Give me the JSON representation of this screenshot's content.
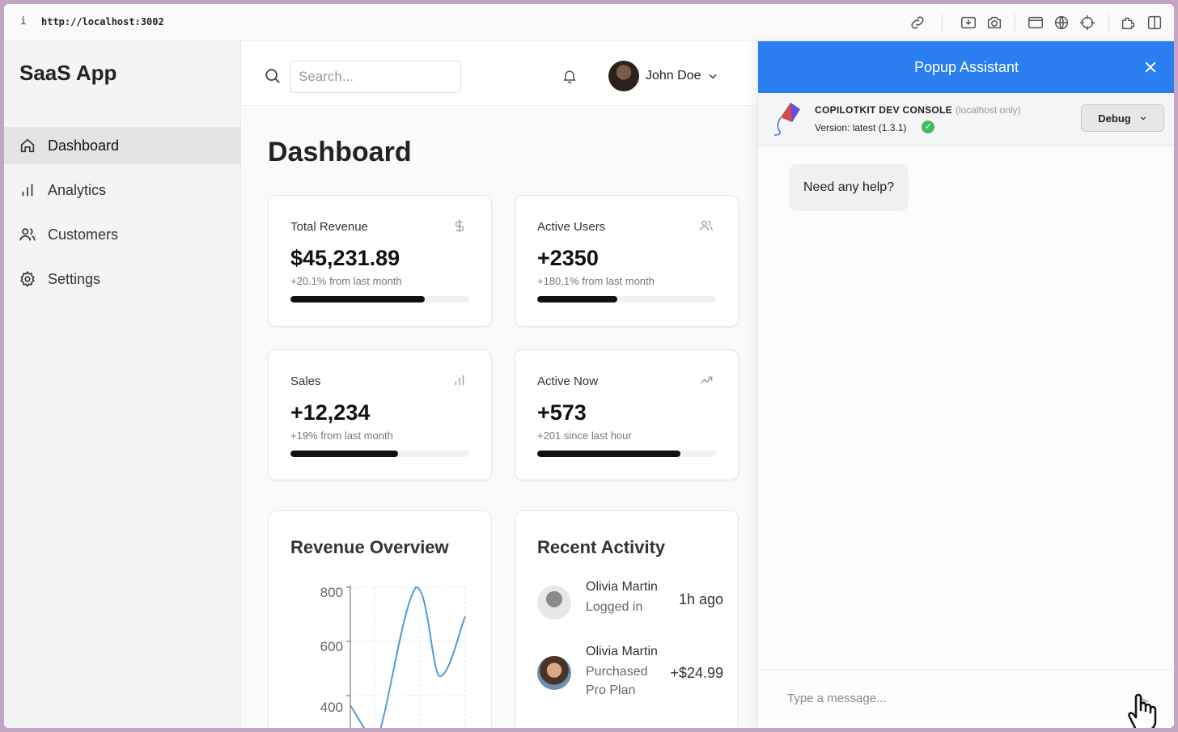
{
  "browser": {
    "info_glyph": "i",
    "url": "http://localhost:3002"
  },
  "sidebar": {
    "brand": "SaaS App",
    "items": [
      {
        "label": "Dashboard",
        "icon": "home-icon",
        "active": true
      },
      {
        "label": "Analytics",
        "icon": "bar-chart-icon",
        "active": false
      },
      {
        "label": "Customers",
        "icon": "users-icon",
        "active": false
      },
      {
        "label": "Settings",
        "icon": "gear-icon",
        "active": false
      }
    ]
  },
  "header": {
    "search_placeholder": "Search...",
    "search_value": "",
    "user_name": "John Doe"
  },
  "main": {
    "title": "Dashboard",
    "stats": [
      {
        "label": "Total Revenue",
        "value": "$45,231.89",
        "sub": "+20.1% from last month",
        "icon": "dollar-icon",
        "progress": 0.75
      },
      {
        "label": "Active Users",
        "value": "+2350",
        "sub": "+180.1% from last month",
        "icon": "users-icon",
        "progress": 0.45
      },
      {
        "label": "Sales",
        "value": "+12,234",
        "sub": "+19% from last month",
        "icon": "bar-chart-icon",
        "progress": 0.6
      },
      {
        "label": "Active Now",
        "value": "+573",
        "sub": "+201 since last hour",
        "icon": "trending-up-icon",
        "progress": 0.8
      }
    ],
    "revenue_overview": {
      "title": "Revenue Overview",
      "y_ticks": [
        "800",
        "600",
        "400"
      ]
    },
    "recent_activity": {
      "title": "Recent Activity",
      "items": [
        {
          "name": "Olivia Martin",
          "desc": "Logged in",
          "meta": "1h ago"
        },
        {
          "name": "Olivia Martin",
          "desc": "Purchased Pro Plan",
          "meta": "+$24.99"
        }
      ]
    }
  },
  "popup": {
    "title": "Popup Assistant",
    "dev_title": "COPILOTKIT DEV CONSOLE",
    "dev_local": "(localhost only)",
    "version": "Version: latest (1.3.1)",
    "debug_label": "Debug",
    "greeting": "Need any help?",
    "input_placeholder": "Type a message..."
  },
  "colors": {
    "accent": "#2b7ef0",
    "chart_line": "#4f9ad6",
    "ok": "#3fbf5c"
  }
}
